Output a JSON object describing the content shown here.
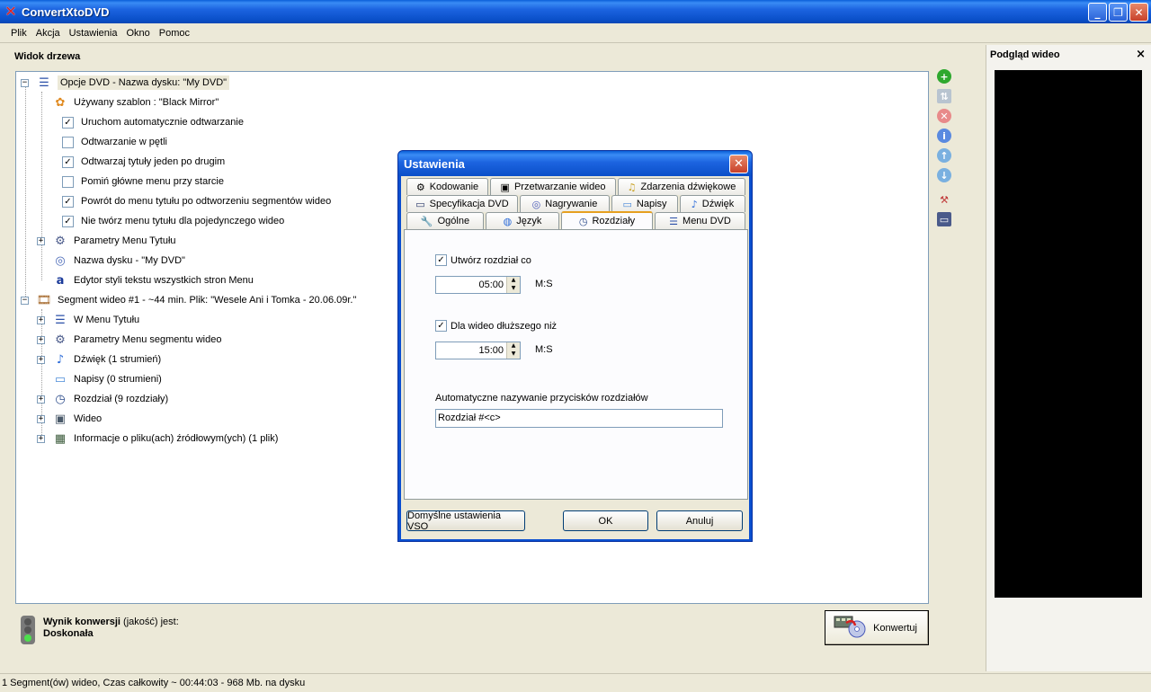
{
  "window": {
    "title": "ConvertXtoDVD"
  },
  "menu": [
    "Plik",
    "Akcja",
    "Ustawienia",
    "Okno",
    "Pomoc"
  ],
  "tree": {
    "header": "Widok drzewa",
    "rows": [
      "Opcje DVD - Nazwa dysku: \"My DVD\"",
      "Używany szablon : \"Black Mirror\"",
      "Uruchom automatycznie odtwarzanie",
      "Odtwarzanie w pętli",
      "Odtwarzaj tytuły jeden po drugim",
      "Pomiń główne menu przy starcie",
      "Powrót do menu tytułu po odtworzeniu segmentów wideo",
      "Nie twórz menu tytułu dla pojedynczego wideo",
      "Parametry Menu Tytułu",
      "Nazwa dysku - \"My DVD\"",
      "Edytor styli tekstu wszystkich stron Menu",
      "Segment wideo #1 - ~44 min. Plik: \"Wesele Ani i Tomka - 20.06.09r.\"",
      "W Menu Tytułu",
      "Parametry Menu segmentu wideo",
      "Dźwięk (1 strumień)",
      "Napisy (0 strumieni)",
      "Rozdział (9 rozdziały)",
      "Wideo",
      "Informacje o pliku(ach) źródłowym(ych) (1 plik)"
    ]
  },
  "preview": {
    "title": "Podgląd wideo"
  },
  "result": {
    "label_bold": "Wynik konwersji",
    "label_rest": " (jakość) jest:",
    "value": "Doskonała"
  },
  "convert_button": "Konwertuj",
  "status": "1 Segment(ów) wideo, Czas całkowity ~ 00:44:03 - 968 Mb. na dysku",
  "dialog": {
    "title": "Ustawienia",
    "tabs_row1": [
      "Kodowanie",
      "Przetwarzanie wideo",
      "Zdarzenia dźwiękowe"
    ],
    "tabs_row2": [
      "Specyfikacja DVD",
      "Nagrywanie",
      "Napisy",
      "Dźwięk"
    ],
    "tabs_row3": [
      "Ogólne",
      "Język",
      "Rozdziały",
      "Menu DVD"
    ],
    "chapter_every_label": "Utwórz rozdział co",
    "chapter_every_value": "05:00",
    "unit": "M:S",
    "longer_than_label": "Dla wideo dłuższego niż",
    "longer_than_value": "15:00",
    "auto_naming_label": "Automatyczne nazywanie przycisków rozdziałów",
    "auto_naming_value": "Rozdział #<c>",
    "defaults_button": "Domyślne ustawienia VSO",
    "ok_button": "OK",
    "cancel_button": "Anuluj"
  }
}
